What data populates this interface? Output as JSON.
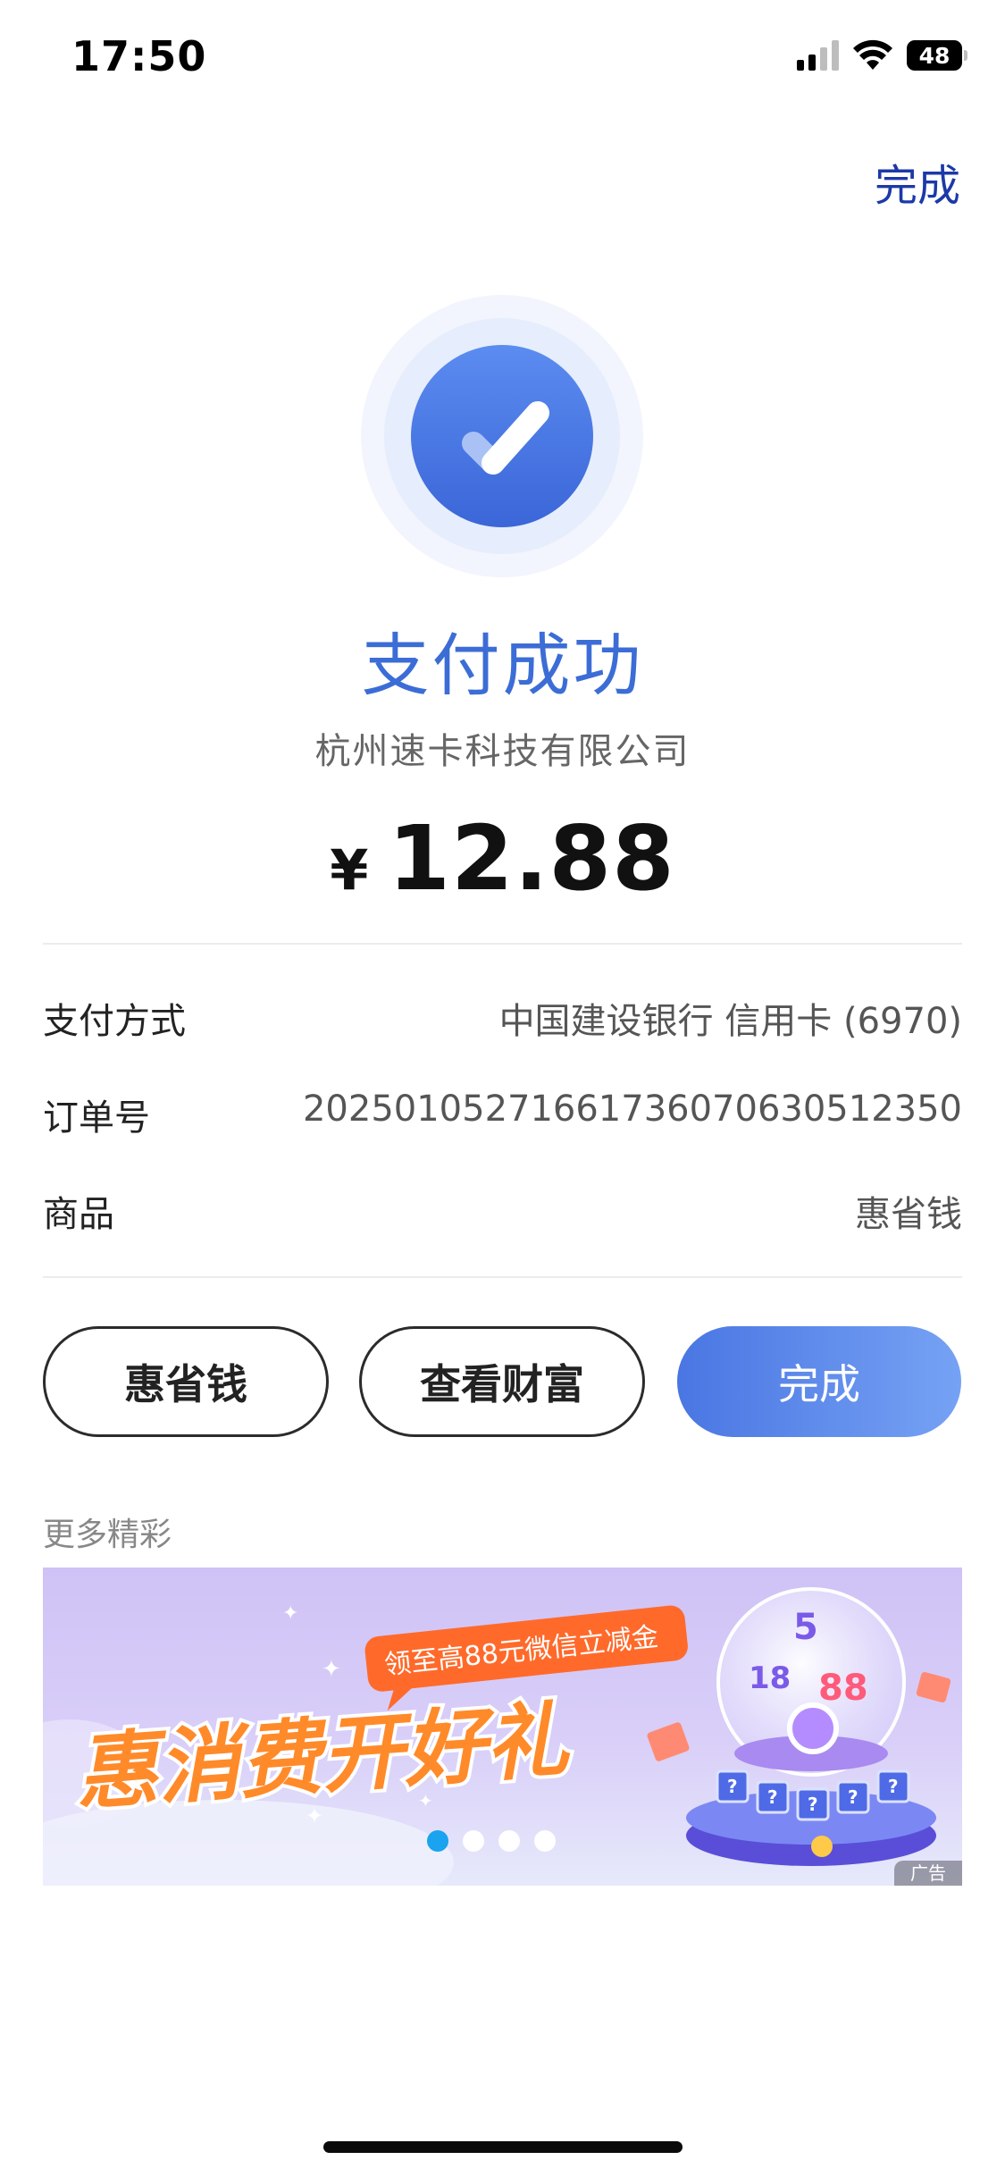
{
  "status_bar": {
    "time": "17:50",
    "battery": "48"
  },
  "header": {
    "done_label": "完成"
  },
  "result": {
    "title": "支付成功",
    "merchant": "杭州速卡科技有限公司",
    "currency": "¥",
    "amount": "12.88"
  },
  "details": [
    {
      "label": "支付方式",
      "value": "中国建设银行 信用卡 (6970)"
    },
    {
      "label": "订单号",
      "value": "2025010527166173607063051235​0"
    },
    {
      "label": "商品",
      "value": "惠省钱"
    }
  ],
  "actions": {
    "secondary_1": "惠省钱",
    "secondary_2": "查看财富",
    "primary": "完成"
  },
  "more": {
    "label": "更多精彩"
  },
  "banner": {
    "headline": "惠消费开好礼",
    "subline": "领至高88元微信立减金",
    "ad_tag": "广告",
    "page_count": 4,
    "active_page": 1
  },
  "colors": {
    "accent": "#3c6dd6",
    "done_link": "#1c39a8",
    "active_dot": "#1aa3ef"
  },
  "icons": [
    "signal-icon",
    "wifi-icon",
    "battery-icon",
    "success-check-icon"
  ]
}
